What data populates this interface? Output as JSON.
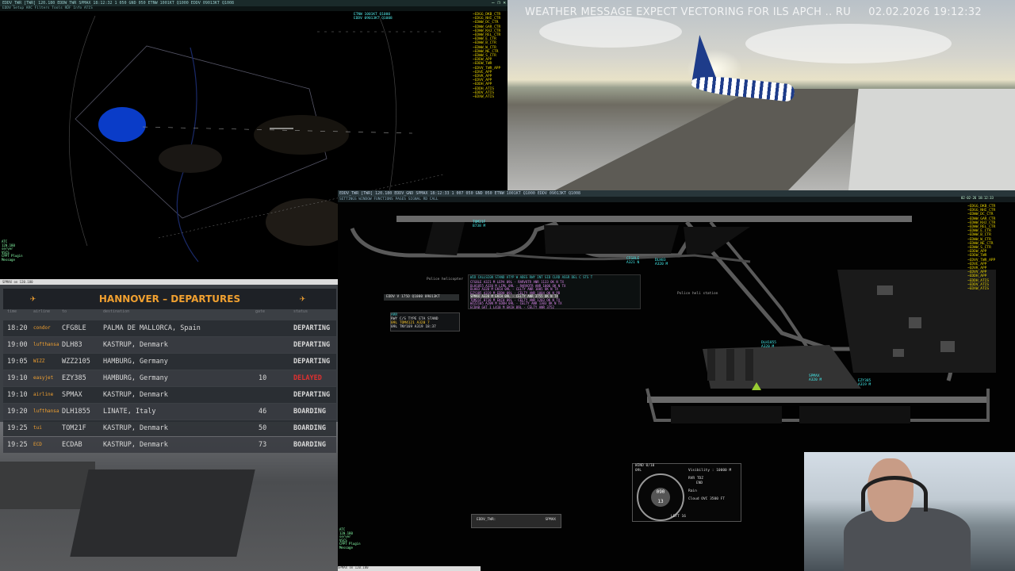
{
  "radar_top": {
    "title_bar": "EDDV_TWR [TWR]   120.180   EDDW_TWR   SPMAX   18:12:32   1   050   GND 050   ETNW 1001KT Q1000   EDDV 09013KT Q1008",
    "menu_bar": "EDDV  Setup  ARC  Filters  Tools  RDF  Info  ATIS",
    "window_buttons": "—  ❐  ✕",
    "freq_list": [
      "~EDGG_DKB_CTR",
      "~EDGG_NHI_CTR",
      "~EDWW_DC_CTR",
      "~EDWW_GAR_CTR",
      "~EDWW_KHJ_CTR",
      "~EDWW_REL_CTR",
      "~EDWW_E_CTR",
      "~EDWW_B_CTR",
      "~EDWW_W_CTR",
      "~EDWW_NE_CTR",
      "~EDWW_S_CTR",
      "~EDDW_APP",
      "~EDDW_TWR",
      "~EDVV_TWR_APP",
      "~EDVE_APP",
      "~EDVK_APP",
      "~EDVV_APP",
      "~EDDH_APP",
      "~EDDH_ATIS",
      "~EDDV_ATIS",
      "~EDXW_ATIS"
    ],
    "ticket_lines": [
      "ETNW 1001KT Q1000",
      "EDDV 09013KT Q1008"
    ],
    "status_lines": [
      "ATC",
      "120.180",
      "server",
      "VSCS",
      "CPPT Plugin",
      "Message"
    ]
  },
  "sim_view": {
    "message": "WEATHER MESSAGE EXPECT VECTORING FOR ILS APCH .. RU",
    "datetime": "02.02.2026 19:12:32"
  },
  "fids": {
    "top_label": "SPMAX on 120.180",
    "title": "HANNOVER – DEPARTURES",
    "col_headers": [
      "time",
      "airline",
      "to",
      "destination",
      "gate",
      "status"
    ],
    "rows": [
      {
        "time": "18:20",
        "flight": "CFG8LE",
        "dest": "PALMA DE MALLORCA, Spain",
        "gate": "",
        "status": "DEPARTING",
        "status_color": "#d8d8d8",
        "logo": "condor"
      },
      {
        "time": "19:00",
        "flight": "DLH83",
        "dest": "KASTRUP, Denmark",
        "gate": "",
        "status": "DEPARTING",
        "status_color": "#d8d8d8",
        "logo": "lufthansa"
      },
      {
        "time": "19:05",
        "flight": "WZZ2105",
        "dest": "HAMBURG, Germany",
        "gate": "",
        "status": "DEPARTING",
        "status_color": "#d8d8d8",
        "logo": "WIZZ"
      },
      {
        "time": "19:10",
        "flight": "EZY385",
        "dest": "HAMBURG, Germany",
        "gate": "10",
        "status": "DELAYED",
        "status_color": "#e03030",
        "logo": "easyjet"
      },
      {
        "time": "19:10",
        "flight": "SPMAX",
        "dest": "KASTRUP, Denmark",
        "gate": "",
        "status": "DEPARTING",
        "status_color": "#d8d8d8",
        "logo": "airline"
      },
      {
        "time": "19:20",
        "flight": "DLH1855",
        "dest": "LINATE, Italy",
        "gate": "46",
        "status": "BOARDING",
        "status_color": "#d8d8d8",
        "logo": "lufthansa"
      },
      {
        "time": "19:25",
        "flight": "TOM21F",
        "dest": "KASTRUP, Denmark",
        "gate": "50",
        "status": "BOARDING",
        "status_color": "#d8d8d8",
        "logo": "tui"
      },
      {
        "time": "19:25",
        "flight": "ECDAB",
        "dest": "KASTRUP, Denmark",
        "gate": "73",
        "status": "BOARDING",
        "status_color": "#d8d8d8",
        "logo": "ECD"
      }
    ]
  },
  "ground_radar": {
    "title_bar": "EDDV_TWR [TWR]   120.180   EDDV_GND   SPMAX   18:12:33   1   007   050   GND 050   ETNW 1001KT Q1000   EDDV 09013KT Q1008",
    "menu_bar": "SETTINGS  WINDOW  FUNCTIONS  PAGES  SIGNAL   RD CALL",
    "date_label": "02-02-26 18:12:33",
    "met_box": "EDDV   V 175D   Q1000   09013KT",
    "arr_box_lines": [
      "ARR",
      "RWY C/S   TYPE ETA  STAND",
      "09L TOM4121   A320  7",
      "09L TNY169    A319 18:37"
    ],
    "flight_list_header": "WID CALLSIGN  STAND  ATYP W  ADES RWY INT   SID   CLRD  ASSR DEL C  STS  T",
    "flight_list_rows": [
      "  CFG8LE          A321 M  LEPA 09L  -  RARVOTR ANR  1133  OK  N  TX",
      "  DLH1855         A320 M  LIML 09L  -  RARVOTR ANR  1006  OK  N  TX",
      "  DLH83           A320 M  EKCH 09L  -  CELTY  ANR  1005  OK  N  TX",
      "  EZY385          A319 M  EDDH 09L  -  CELTY  ANR  1004  OK  N  PB",
      "  SPMAX           A320 M  EKCH 09L  -  CELTY  ANR  3755  OK  N  TX",
      "  TOM21F          B738 M  EKCH 09L  -  CELTY  ANR  1203  OK  N  TX",
      "  WZZ2105         A20N M  EDDH 09L  -  CELTY  ANR  1303  OK  N  TX",
      "  ECDAB     GAT 1 L410 M  EKCH 09L  -  CELTY  ANR  3752"
    ],
    "labels": [
      {
        "text": "CFG8LE",
        "sub": "A321 N"
      },
      {
        "text": "DLH83",
        "sub": "A320 M"
      },
      {
        "text": "DLH1855",
        "sub": "A320 M"
      },
      {
        "text": "EZY385",
        "sub": "A319 M"
      },
      {
        "text": "TOM21F",
        "sub": "B738 M"
      },
      {
        "text": "SPMAX",
        "sub": "A320 M"
      }
    ],
    "place_labels": [
      "Police helicopter",
      "Police heli station"
    ],
    "wind": {
      "title": "WIND 0/10",
      "rwy": "09L",
      "visibility": "Visibility : 10000 M",
      "rvr": "RVR TDZ",
      "end": "END",
      "rain": "Rain",
      "cloud": "Cloud      OVC  3500 FT",
      "dial_value": "090",
      "dial_speed": "13",
      "left": "LEFT 16"
    },
    "cmd_box": {
      "label": "EDDV_TWR:",
      "value": "SPMAX"
    },
    "status_lines": [
      "ATC",
      "120.180",
      "server",
      "VSCS",
      "CPPT Plugin",
      "Message"
    ],
    "bottom_label": "SPMAX on 120.180",
    "freq_list": [
      "~EDGG_DKB_CTR",
      "~EDGG_NHI_CTR",
      "~EDWW_DC_CTR",
      "~EDWW_GAR_CTR",
      "~EDWW_KHJ_CTR",
      "~EDWW_REL_CTR",
      "~EDWW_E_CTR",
      "~EDWW_B_CTR",
      "~EDWW_W_CTR",
      "~EDWW_NE_CTR",
      "~EDWW_S_CTR",
      "~EDDW_APP",
      "~EDDW_TWR",
      "~EDVV_TWR_APP",
      "~EDVE_APP",
      "~EDVK_APP",
      "~EDVV_APP",
      "~EDDH_APP",
      "~EDDH_ATIS",
      "~EDDV_ATIS",
      "~EDXW_ATIS"
    ]
  }
}
